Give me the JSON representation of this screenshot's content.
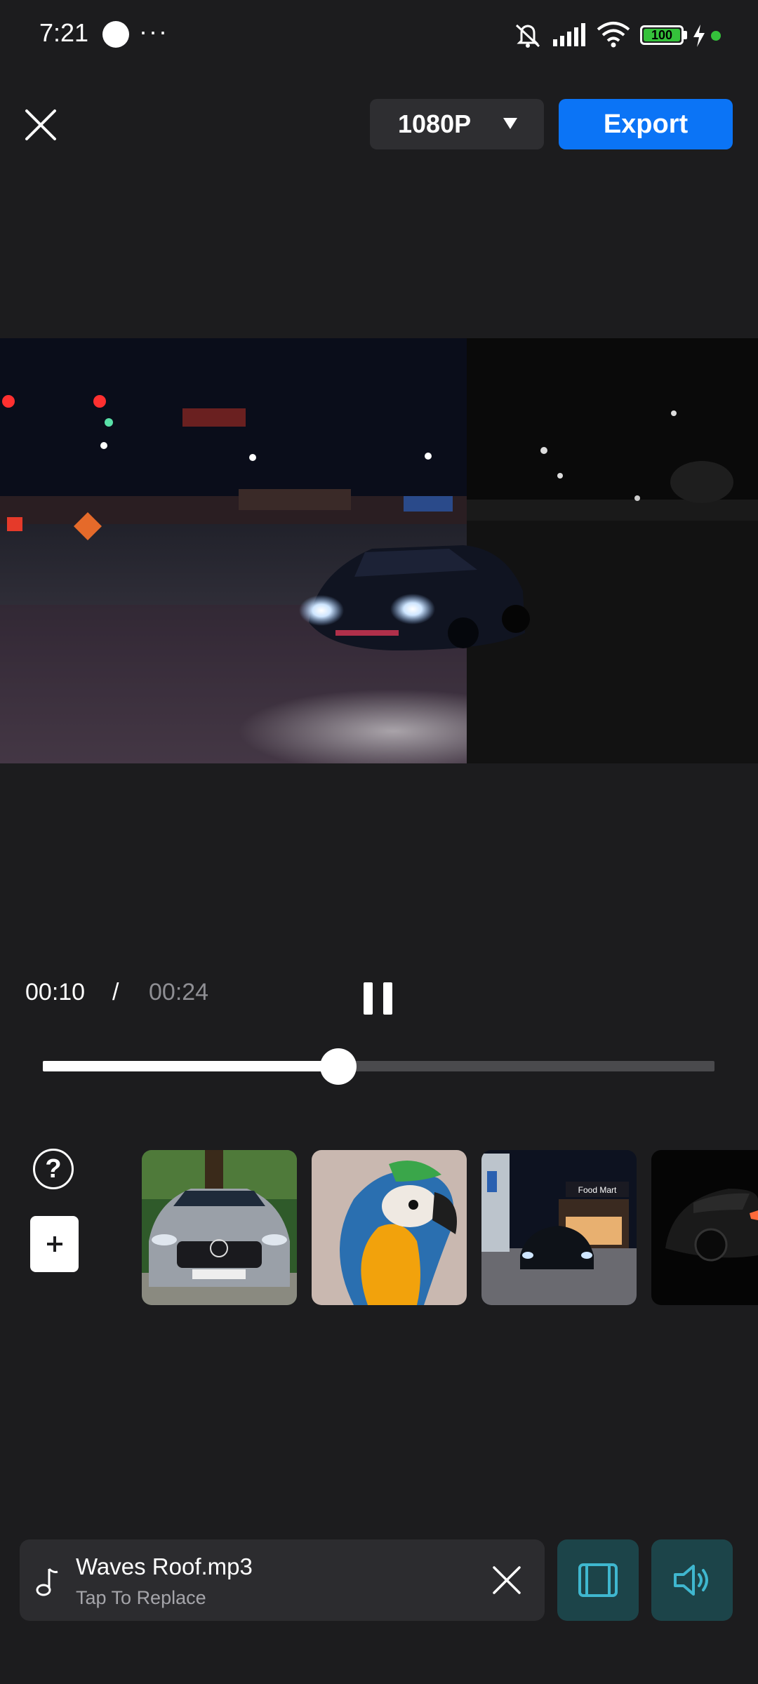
{
  "status_bar": {
    "time": "7:21",
    "more": "···",
    "battery": "100",
    "icons": [
      "app-icon",
      "mute-icon",
      "signal-icon",
      "wifi-icon",
      "battery-icon",
      "charging-icon"
    ]
  },
  "top_bar": {
    "resolution": "1080P",
    "export_label": "Export"
  },
  "playback": {
    "current": "00:10",
    "separator": "/",
    "total": "00:24",
    "progress": 0.44
  },
  "clips": [
    {
      "subject": "silver AMG car"
    },
    {
      "subject": "macaw parrot"
    },
    {
      "subject": "car at food mart"
    },
    {
      "subject": "black sports car"
    }
  ],
  "music": {
    "title": "Waves Roof.mp3",
    "subtitle": "Tap To Replace"
  },
  "colors": {
    "background": "#1c1c1e",
    "accent": "#0b74f6",
    "tool_button": "#1c4449",
    "tool_icon": "#3fb7cf"
  }
}
